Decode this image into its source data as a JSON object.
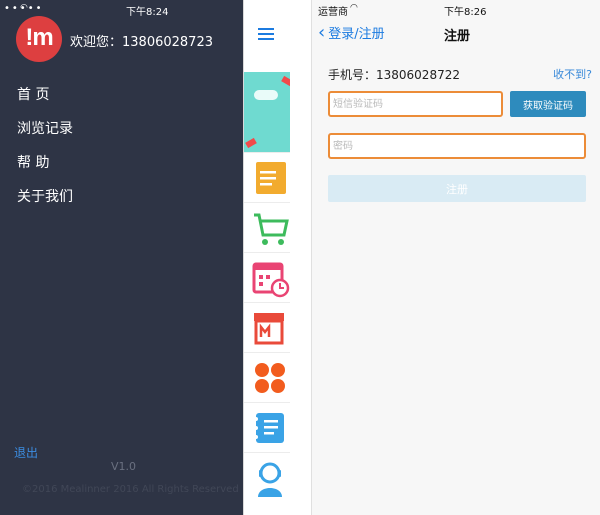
{
  "left_screen": {
    "status_bar": {
      "carrier": "•••••",
      "time": "下午8:24"
    },
    "profile": {
      "avatar_text": "!m",
      "welcome": "欢迎您：13806028723"
    },
    "menu": [
      {
        "label": "首 页"
      },
      {
        "label": "浏览记录"
      },
      {
        "label": "帮 助"
      },
      {
        "label": "关于我们"
      }
    ],
    "logout": "退出",
    "version": "V1.0",
    "copyright": "©2016 Mealinner 2016 All Rights Reserved",
    "main_peek_icons": [
      "banner-image",
      "document-icon",
      "cart-icon",
      "calendar-clock-icon",
      "store-icon",
      "grid-icon",
      "notebook-icon",
      "service-agent-icon"
    ]
  },
  "right_screen": {
    "status_bar": {
      "carrier": "运营商",
      "time": "下午8:26"
    },
    "nav": {
      "back_label": "登录/注册",
      "title": "注册"
    },
    "phone_label": "手机号：13806028722",
    "not_received": "收不到?",
    "sms_placeholder": "短信验证码",
    "get_code_label": "获取验证码",
    "password_placeholder": "密码",
    "register_label": "注册"
  },
  "colors": {
    "drawer_bg": "#2e3445",
    "avatar_red": "#dd3f40",
    "ios_blue": "#1c7be0",
    "input_border_orange": "#ec8c38",
    "get_code_bg": "#2e8bbd",
    "register_disabled_bg": "#d9ebf4"
  }
}
